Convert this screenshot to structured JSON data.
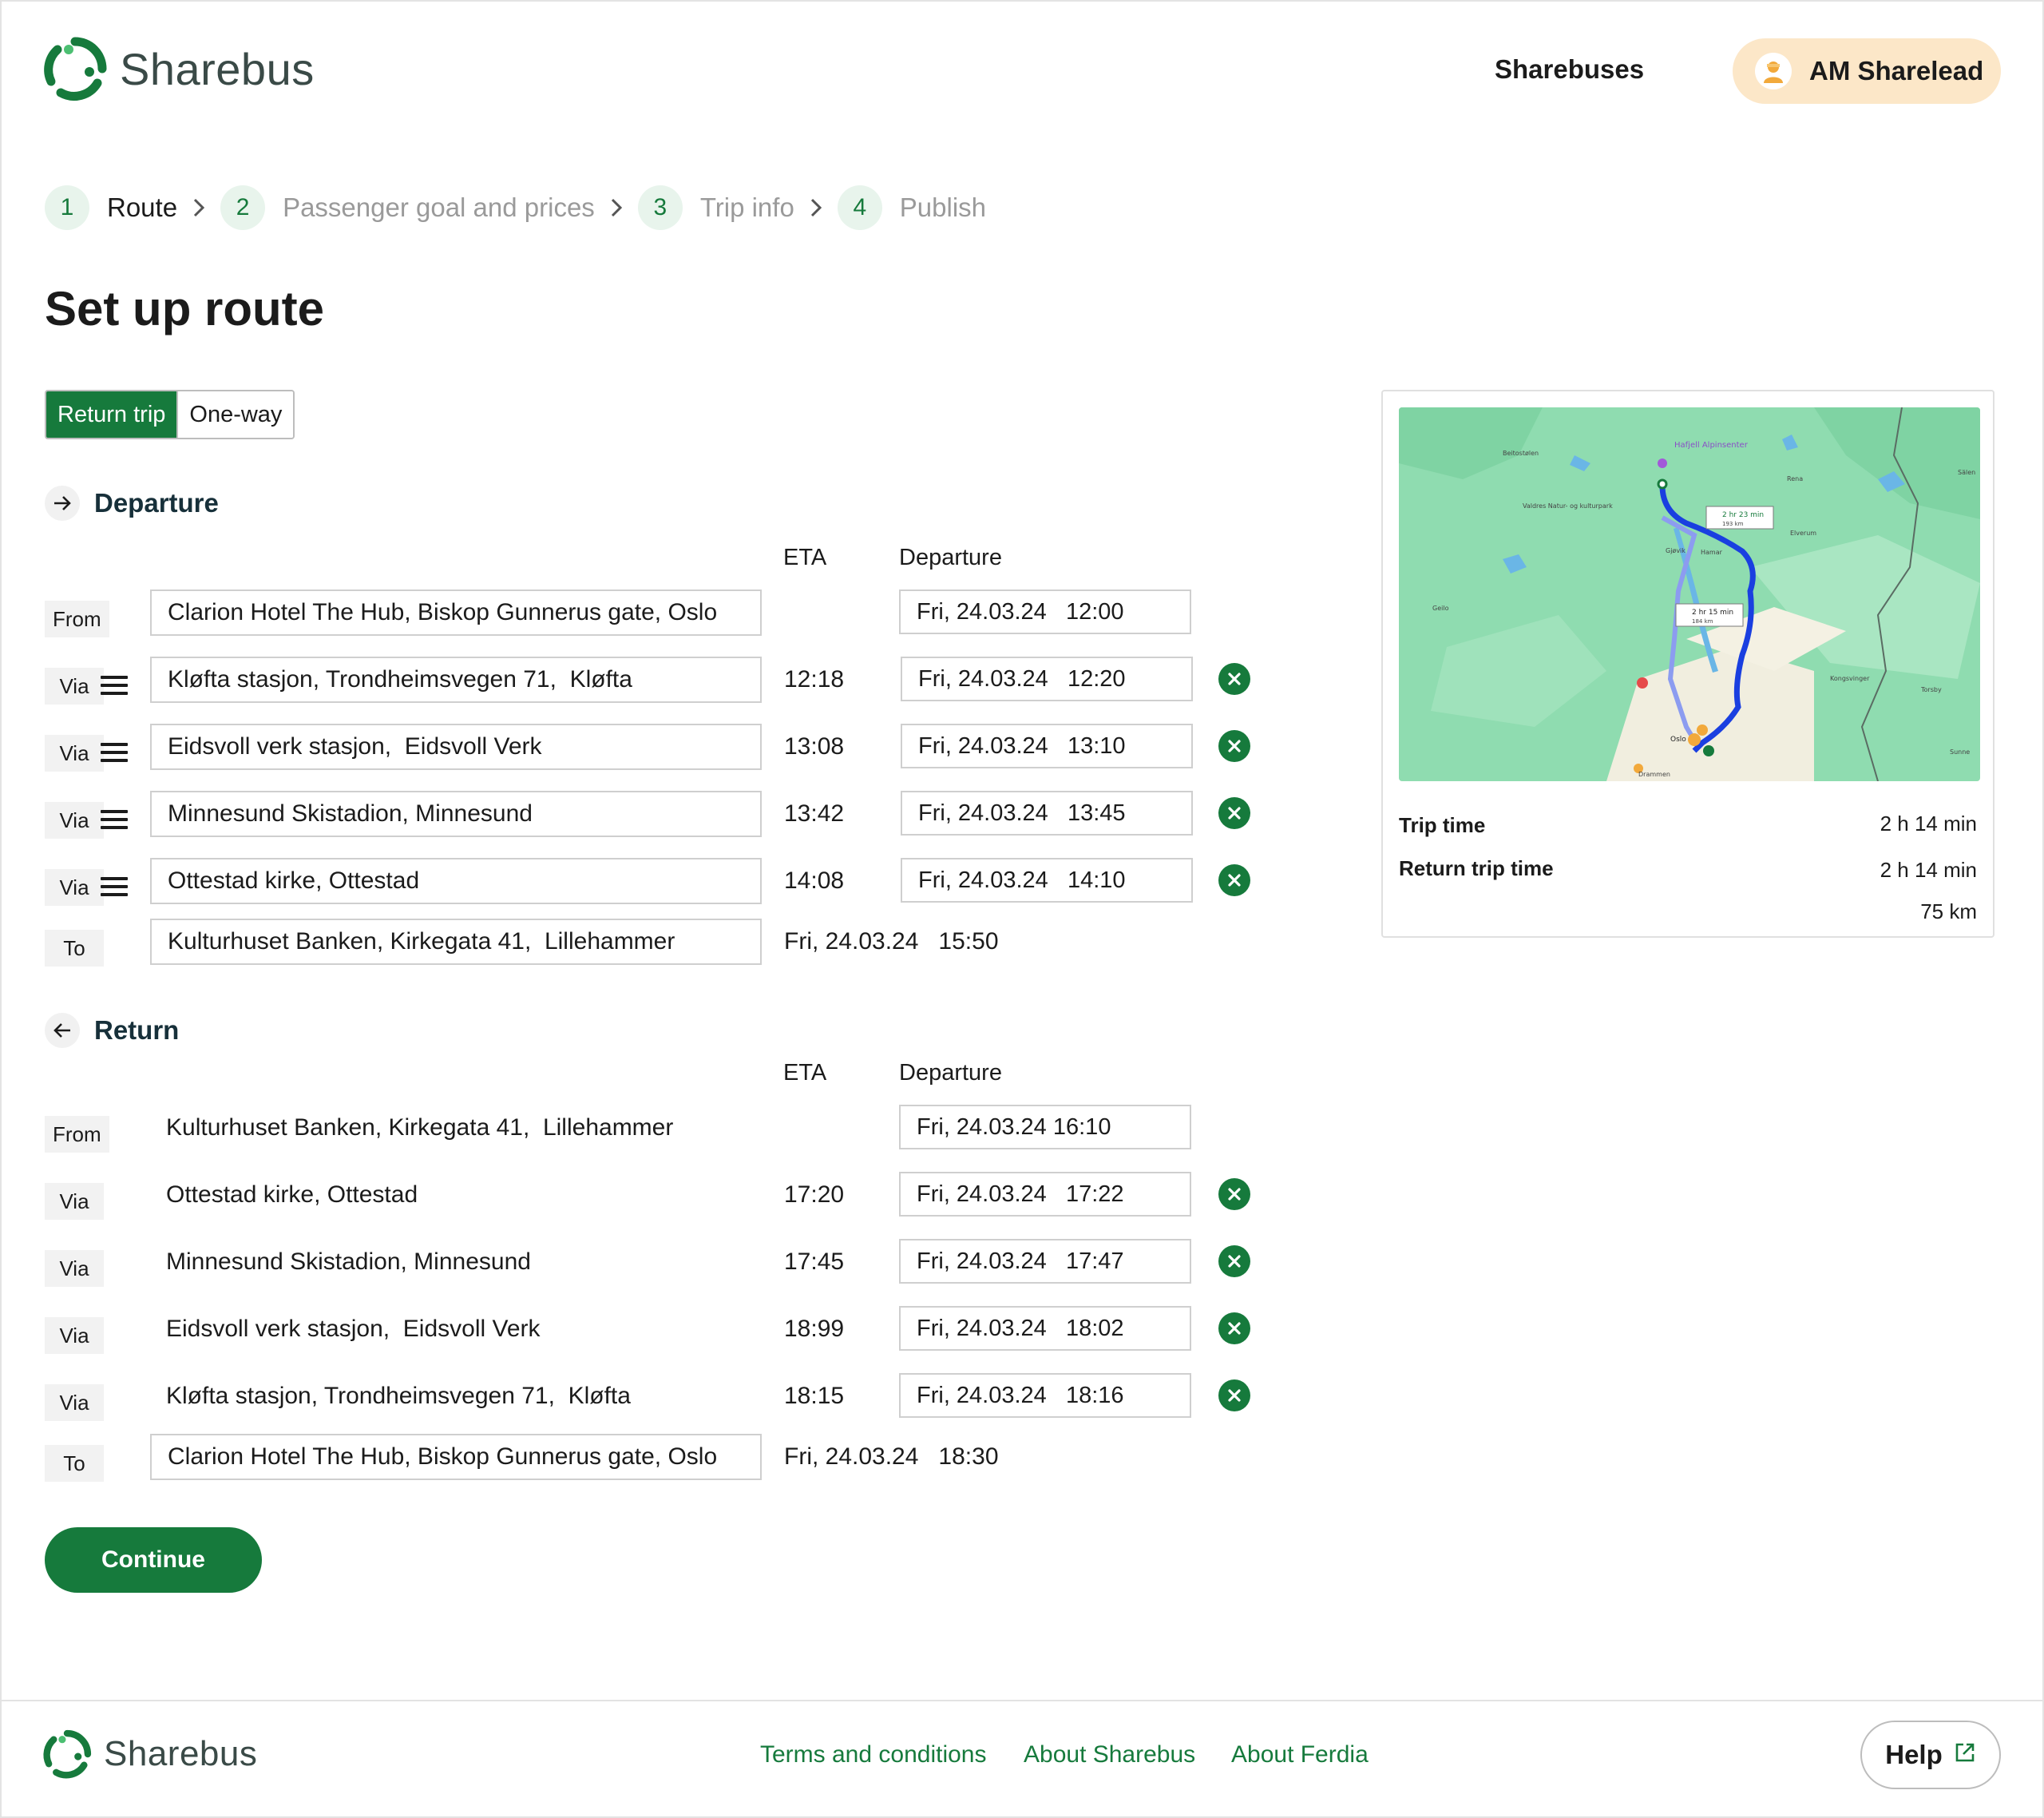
{
  "header": {
    "brand": "Sharebus",
    "nav_sharebuses": "Sharebuses",
    "user_name": "AM Sharelead"
  },
  "steps": [
    {
      "num": "1",
      "label": "Route"
    },
    {
      "num": "2",
      "label": "Passenger goal and prices"
    },
    {
      "num": "3",
      "label": "Trip info"
    },
    {
      "num": "4",
      "label": "Publish"
    }
  ],
  "page_title": "Set up route",
  "trip_type": {
    "return": "Return trip",
    "oneway": "One-way",
    "selected": "Return trip"
  },
  "departure": {
    "title": "Departure",
    "eta_header": "ETA",
    "departure_header": "Departure",
    "rows": [
      {
        "tag": "From",
        "location": "Clarion Hotel The Hub, Biskop Gunnerus gate, Oslo",
        "eta": "",
        "departure": "Fri, 24.03.24   12:00"
      },
      {
        "tag": "Via",
        "location": "Kløfta stasjon, Trondheimsvegen 71,  Kløfta",
        "eta": "12:18",
        "departure": "Fri, 24.03.24   12:20"
      },
      {
        "tag": "Via",
        "location": "Eidsvoll verk stasjon,  Eidsvoll Verk",
        "eta": "13:08",
        "departure": "Fri, 24.03.24   13:10"
      },
      {
        "tag": "Via",
        "location": "Minnesund Skistadion, Minnesund",
        "eta": "13:42",
        "departure": "Fri, 24.03.24   13:45"
      },
      {
        "tag": "Via",
        "location": "Ottestad kirke, Ottestad",
        "eta": "14:08",
        "departure": "Fri, 24.03.24   14:10"
      },
      {
        "tag": "To",
        "location": "Kulturhuset Banken, Kirkegata 41,  Lillehammer",
        "eta": "Fri, 24.03.24   15:50",
        "departure": ""
      }
    ]
  },
  "return": {
    "title": "Return",
    "eta_header": "ETA",
    "departure_header": "Departure",
    "rows": [
      {
        "tag": "From",
        "location": "Kulturhuset Banken, Kirkegata 41,  Lillehammer",
        "eta": "",
        "departure": "Fri, 24.03.24 16:10"
      },
      {
        "tag": "Via",
        "location": "Ottestad kirke, Ottestad",
        "eta": "17:20",
        "departure": "Fri, 24.03.24   17:22"
      },
      {
        "tag": "Via",
        "location": "Minnesund Skistadion, Minnesund",
        "eta": "17:45",
        "departure": "Fri, 24.03.24   17:47"
      },
      {
        "tag": "Via",
        "location": "Eidsvoll verk stasjon,  Eidsvoll Verk",
        "eta": "18:99",
        "departure": "Fri, 24.03.24   18:02"
      },
      {
        "tag": "Via",
        "location": "Kløfta stasjon, Trondheimsvegen 71,  Kløfta",
        "eta": "18:15",
        "departure": "Fri, 24.03.24   18:16"
      },
      {
        "tag": "To",
        "location": "Clarion Hotel The Hub, Biskop Gunnerus gate, Oslo",
        "eta": "Fri, 24.03.24   18:30",
        "departure": ""
      }
    ]
  },
  "continue_label": "Continue",
  "summary": {
    "trip_time_label": "Trip time",
    "trip_time": "2 h 14 min",
    "return_time_label": "Return trip time",
    "return_time": "2 h 14 min",
    "distance": "75 km"
  },
  "map": {
    "labels": {
      "hafjell": "Hafjell Alpinsenter",
      "beitostolen": "Beitostølen",
      "valdres": "Valdres Natur- og kulturpark",
      "rena": "Rena",
      "elverum": "Elverum",
      "gjovik": "Gjøvik",
      "hamar": "Hamar",
      "geilo": "Geilo",
      "kongsvinger": "Kongsvinger",
      "torsby": "Torsby",
      "salen": "Sälen",
      "sunne": "Sunne",
      "oslo": "Oslo",
      "drammen": "Drammen",
      "route1_time": "2 hr 23 min",
      "route1_dist": "193 km",
      "route2_time": "2 hr 15 min",
      "route2_dist": "184 km"
    }
  },
  "footer": {
    "brand": "Sharebus",
    "terms": "Terms and conditions",
    "about_sharebus": "About Sharebus",
    "about_ferdia": "About Ferdia",
    "help": "Help"
  },
  "colors": {
    "primary": "#167a3c",
    "user_pill": "#fce7c8",
    "map_green": "#8fdcb0",
    "route_blue": "#1a3fe0"
  }
}
